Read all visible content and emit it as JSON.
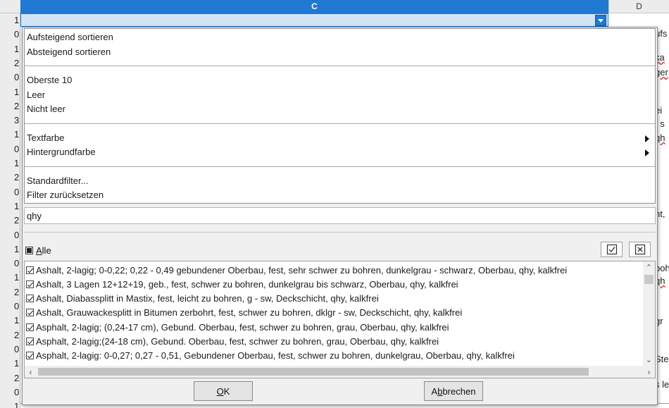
{
  "sheet": {
    "columns": [
      "C",
      "D"
    ],
    "row_values": [
      "1",
      "0",
      "1",
      "2",
      "0",
      "1",
      "2",
      "3",
      "1",
      "0",
      "1",
      "2",
      "0",
      "1",
      "2",
      "0",
      "1",
      "0",
      "1",
      "2",
      "0",
      "1",
      "2",
      "0",
      "1",
      "2",
      "0",
      "1"
    ],
    "d_column_fragments": [
      "ufs",
      "ka",
      "ger",
      "ei",
      ", s",
      "qh",
      ")",
      "nt,",
      "boh",
      "qh",
      "gr",
      "Ste",
      "s le"
    ]
  },
  "menu": {
    "sort_asc": "Aufsteigend sortieren",
    "sort_desc": "Absteigend sortieren",
    "top10": "Oberste 10",
    "empty": "Leer",
    "not_empty": "Nicht leer",
    "text_color": "Textfarbe",
    "bg_color": "Hintergrundfarbe",
    "standard_filter": "Standardfilter...",
    "reset_filter": "Filter zurücksetzen"
  },
  "search": {
    "value": "qhy"
  },
  "all": {
    "label_prefix": "",
    "label_u": "A",
    "label_rest": "lle"
  },
  "list": [
    "Ashalt, 2-lagig; 0-0,22; 0,22 - 0,49 gebundener Oberbau, fest, sehr schwer zu bohren, dunkelgrau - schwarz, Oberbau, qhy, kalkfrei",
    "Ashalt, 3 Lagen 12+12+19, geb., fest, schwer zu bohren, dunkelgrau bis schwarz, Oberbau, qhy, kalkfrei",
    "Ashalt, Diabassplitt in Mastix, fest, leicht zu bohren, g - sw, Deckschicht, qhy, kalkfrei",
    "Ashalt, Grauwackesplitt in Bitumen zerbohrt, fest, schwer zu bohren, dklgr - sw, Deckschicht, qhy, kalkfrei",
    "Asphalt, 2-lagig; (0,24-17 cm), Gebund. Oberbau, fest, schwer zu bohren, grau, Oberbau, qhy, kalkfrei",
    "Asphalt, 2-lagig;(24-18 cm), Gebund. Oberbau, fest, schwer zu bohren, grau, Oberbau, qhy, kalkfrei",
    "Asphalt, 2-lagig: 0-0,27; 0,27 - 0,51, Gebundener Oberbau, fest, schwer zu bohren, dunkelgrau, Oberbau, qhy, kalkfrei"
  ],
  "buttons": {
    "ok_u": "O",
    "ok_rest": "K",
    "cancel_prefix": "A",
    "cancel_u": "b",
    "cancel_rest": "brechen"
  },
  "colors": {
    "accent": "#1f78d1",
    "selection": "#d4e4f7"
  }
}
